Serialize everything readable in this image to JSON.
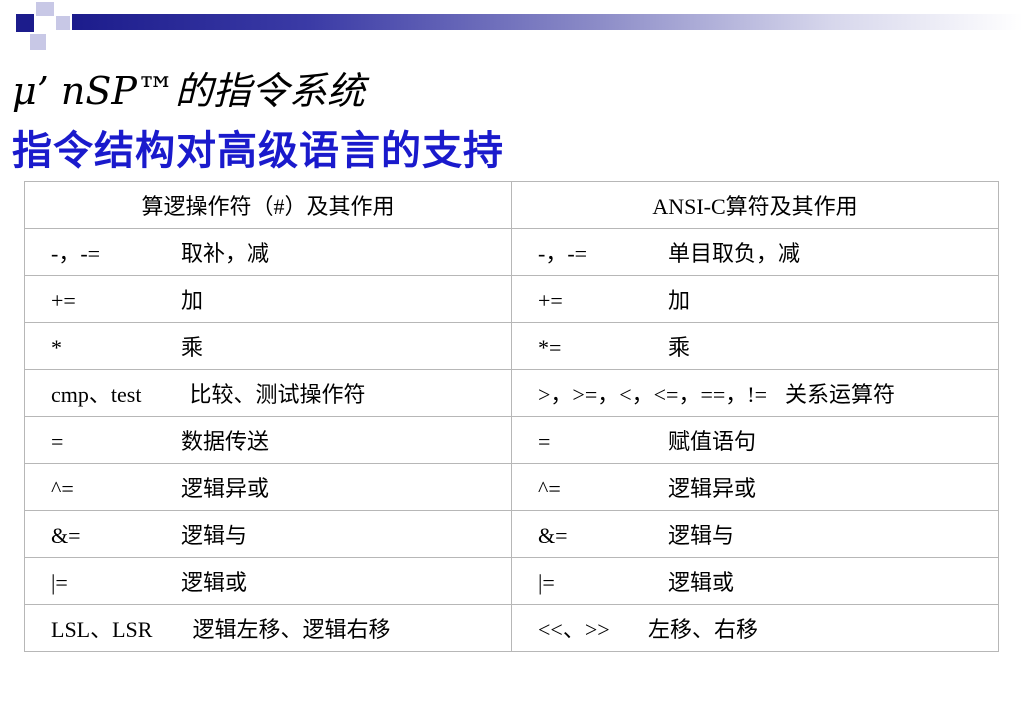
{
  "title": {
    "line1": "μ’ nSP™的指令系统",
    "line2": "指令结构对高级语言的支持"
  },
  "table": {
    "headers": [
      "算逻操作符（#）及其作用",
      "ANSI-C算符及其作用"
    ],
    "rows": [
      {
        "left_op": "-，-=",
        "left_desc": "取补，减",
        "right_op": "-，-=",
        "right_desc": "单目取负，减"
      },
      {
        "left_op": "+=",
        "left_desc": "加",
        "right_op": "+=",
        "right_desc": "加"
      },
      {
        "left_op": "*",
        "left_desc": "乘",
        "right_op": "*=",
        "right_desc": "乘"
      },
      {
        "left_op": "cmp、test",
        "left_desc": "比较、测试操作符",
        "right_op": ">，>=，<，<=，==，!=",
        "right_desc": "关系运算符"
      },
      {
        "left_op": "=",
        "left_desc": "数据传送",
        "right_op": "=",
        "right_desc": "赋值语句"
      },
      {
        "left_op": "^=",
        "left_desc": "逻辑异或",
        "right_op": "^=",
        "right_desc": "逻辑异或"
      },
      {
        "left_op": "&=",
        "left_desc": "逻辑与",
        "right_op": "&=",
        "right_desc": "逻辑与"
      },
      {
        "left_op": "|=",
        "left_desc": "逻辑或",
        "right_op": "|=",
        "right_desc": "逻辑或"
      },
      {
        "left_op": "LSL、LSR",
        "left_desc": "逻辑左移、逻辑右移",
        "right_op": "<<、>>",
        "right_desc": "左移、右移"
      }
    ]
  },
  "colors": {
    "title2": "#1a1acc",
    "deco_dark": "#1c1c8c",
    "deco_light": "#b6b6e0",
    "table_border": "#b7b7b7"
  }
}
